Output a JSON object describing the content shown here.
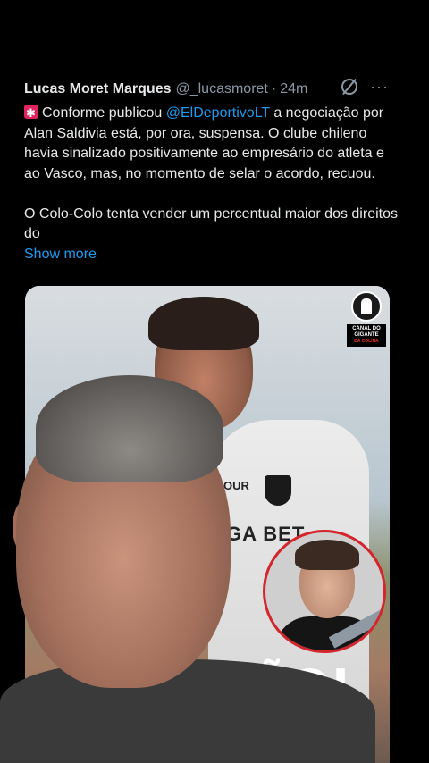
{
  "tweet": {
    "author_name": "Lucas Moret Marques",
    "author_handle": "@_lucasmoret",
    "separator": "·",
    "time": "24m",
    "more_icon": "···",
    "text_part1": "Conforme publicou ",
    "mention": "@ElDeportivoLT",
    "text_part2": " a negociação por Alan Saldivia está, por ora, suspensa. O clube chileno havia sinalizado positivamente ao empresário do atleta e ao Vasco, mas, no momento de selar o acordo, recuou.\n\nO Colo-Colo tenta vender um percentual maior dos direitos do",
    "show_more": "Show more"
  },
  "media": {
    "logo_line1": "CANAL DO",
    "logo_line2": "GIGANTE",
    "logo_line3": "DA COLINA",
    "shirt_top": "OUR",
    "shirt_sponsor": "GA BET",
    "headline": "ÃO!"
  },
  "icons": {
    "siren": "siren-icon",
    "grok": "grok-icon",
    "more": "more-icon"
  },
  "colors": {
    "background": "#000000",
    "text": "#e7e9ea",
    "secondary": "#8b98a5",
    "link": "#1d9bf0",
    "inset_border": "#d4242c"
  }
}
